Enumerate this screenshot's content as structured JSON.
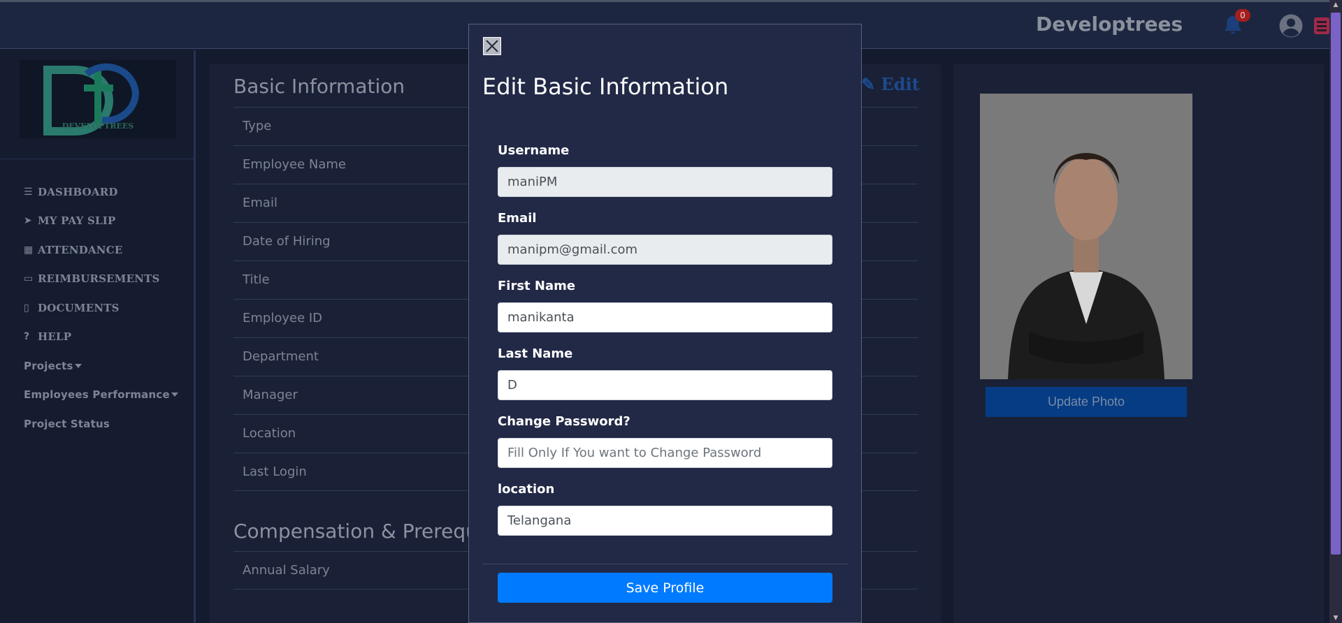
{
  "header": {
    "brand": "Developtrees",
    "notification_count": "0"
  },
  "sidebar": {
    "logo_text": "DEVELOPTREES",
    "items": [
      {
        "icon": "bars-icon",
        "label": "DASHBOARD"
      },
      {
        "icon": "paper-plane-icon",
        "label": "MY PAY SLIP"
      },
      {
        "icon": "calendar-icon",
        "label": "ATTENDANCE"
      },
      {
        "icon": "credit-card-icon",
        "label": "REIMBURSEMENTS"
      },
      {
        "icon": "file-icon",
        "label": "DOCUMENTS"
      },
      {
        "icon": "question-circle-icon",
        "label": "HELP"
      }
    ],
    "dropdowns": [
      {
        "label": "Projects"
      },
      {
        "label": "Employees Performance"
      }
    ],
    "plain_links": [
      {
        "label": "Project Status"
      }
    ]
  },
  "basic_info": {
    "title": "Basic Information",
    "edit_label": "Edit",
    "rows": [
      "Type",
      "Employee Name",
      "Email",
      "Date of Hiring",
      "Title",
      "Employee ID",
      "Department",
      "Manager",
      "Location",
      "Last Login"
    ]
  },
  "compensation": {
    "title": "Compensation & Prerequ",
    "rows": [
      "Annual Salary"
    ]
  },
  "photo_card": {
    "update_label": "Update Photo"
  },
  "modal": {
    "title": "Edit Basic Information",
    "fields": {
      "username": {
        "label": "Username",
        "value": "maniPM"
      },
      "email": {
        "label": "Email",
        "value": "manipm@gmail.com"
      },
      "first_name": {
        "label": "First Name",
        "value": "manikanta"
      },
      "last_name": {
        "label": "Last Name",
        "value": "D"
      },
      "password": {
        "label": "Change Password?",
        "value": "",
        "placeholder": "Fill Only If You want to Change Password"
      },
      "location": {
        "label": "location",
        "value": "Telangana"
      }
    },
    "save_label": "Save Profile"
  },
  "colors": {
    "primary": "#007bff",
    "modal_bg": "#222946",
    "page_bg": "#141b2f",
    "badge": "#a61d1d"
  }
}
